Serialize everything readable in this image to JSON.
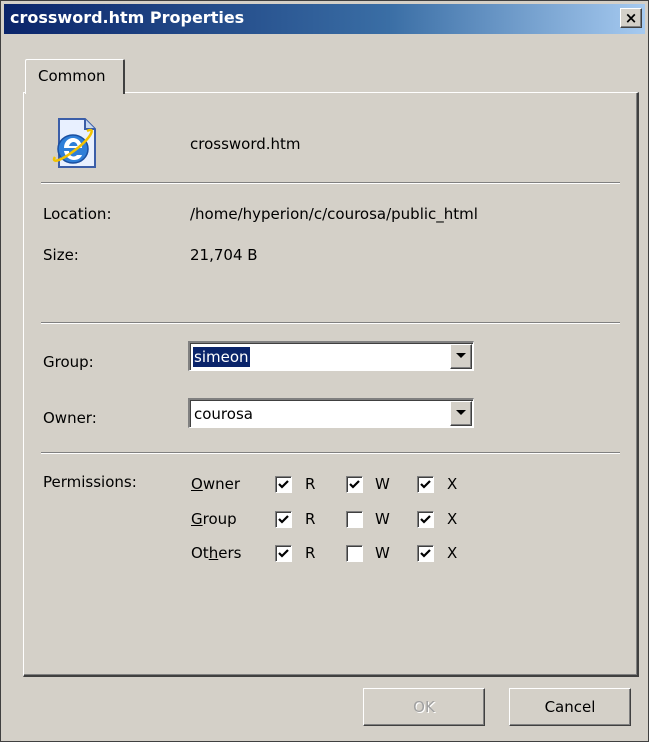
{
  "window": {
    "title": "crossword.htm Properties",
    "close_glyph": "×"
  },
  "tabs": [
    {
      "label": "Common",
      "active": true
    }
  ],
  "file": {
    "icon": "ie-document-icon",
    "name": "crossword.htm"
  },
  "info": {
    "location_label": "Location:",
    "location_value": "/home/hyperion/c/courosa/public_html",
    "size_label": "Size:",
    "size_value": "21,704 B"
  },
  "group": {
    "label": "Group:",
    "value": "simeon"
  },
  "owner": {
    "label": "Owner:",
    "value": "courosa"
  },
  "permissions": {
    "label": "Permissions:",
    "rows": [
      {
        "label_pre": "",
        "label_u": "O",
        "label_post": "wner",
        "r": true,
        "w": true,
        "x": true
      },
      {
        "label_pre": "",
        "label_u": "G",
        "label_post": "roup",
        "r": true,
        "w": false,
        "x": true
      },
      {
        "label_pre": "Ot",
        "label_u": "h",
        "label_post": "ers",
        "r": true,
        "w": false,
        "x": true
      }
    ],
    "r_letter": "R",
    "w_letter": "W",
    "x_letter": "X"
  },
  "buttons": {
    "ok": "OK",
    "ok_enabled": false,
    "cancel": "Cancel"
  },
  "colors": {
    "face": "#d4d0c8",
    "titlebar": "#0a246a",
    "selection": "#0a246a"
  }
}
